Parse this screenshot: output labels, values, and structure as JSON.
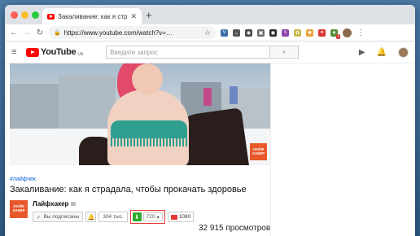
{
  "browser": {
    "tab_title": "Закаливание: как я страдал",
    "tab_close": "✕",
    "new_tab": "+",
    "url": "https://www.youtube.com/watch?v=…"
  },
  "youtube": {
    "logo_text": "YouTube",
    "region": "UA",
    "search_placeholder": "Введите запрос"
  },
  "video": {
    "hashtag": "#лайфчек",
    "title": "Закаливание: как я страдала, чтобы прокачать здоровье",
    "watermark_line1": "ЛАЙФ",
    "watermark_line2": "ХАКЕР",
    "views": "32 915 просмотров"
  },
  "channel": {
    "name": "Лайфхакер",
    "avatar_line1": "ЛАЙФ",
    "avatar_line2": "ХАКЕР",
    "subscribed_label": "Вы подписаны",
    "subscriber_count": "304 тыс."
  },
  "download": {
    "quality": "720",
    "youtube_count": "1080"
  },
  "colors": {
    "youtube_red": "#ff0000",
    "download_green": "#2eaa2e",
    "highlight_frame": "#e53935",
    "brand_orange": "#e8582a"
  }
}
